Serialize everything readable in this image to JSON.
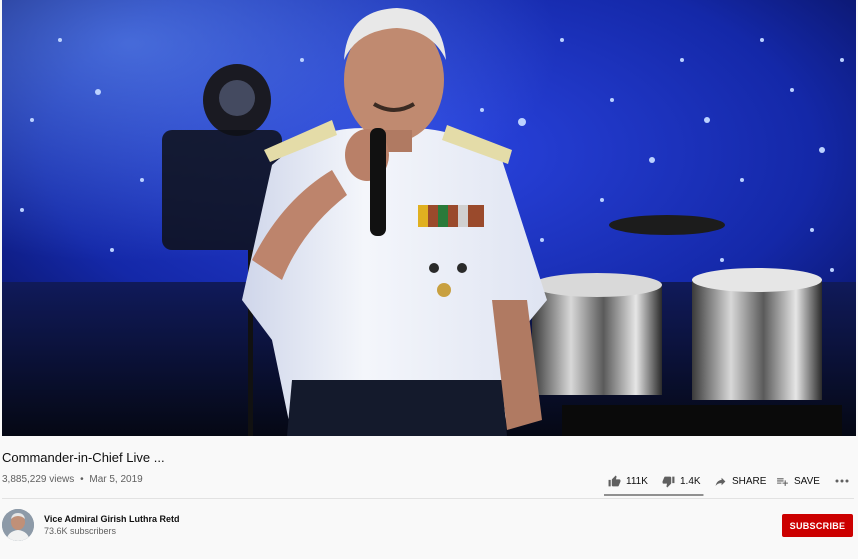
{
  "video": {
    "title": "Commander-in-Chief Live ...",
    "views": "3,885,229 views",
    "separator": "•",
    "date": "Mar 5, 2019"
  },
  "actions": {
    "like_count": "111K",
    "dislike_count": "1.4K",
    "share_label": "SHARE",
    "save_label": "SAVE",
    "like_ratio": 0.988
  },
  "channel": {
    "name": "Vice Admiral Girish Luthra Retd",
    "subscribers": "73.6K subscribers",
    "subscribe_label": "SUBSCRIBE"
  },
  "colors": {
    "subscribe": "#cc0000",
    "stage_blue": "#1a2fc0",
    "uniform": "#f2f4f8"
  },
  "icons": [
    "thumbs-up-icon",
    "thumbs-down-icon",
    "share-arrow-icon",
    "playlist-add-icon",
    "more-horiz-icon"
  ]
}
